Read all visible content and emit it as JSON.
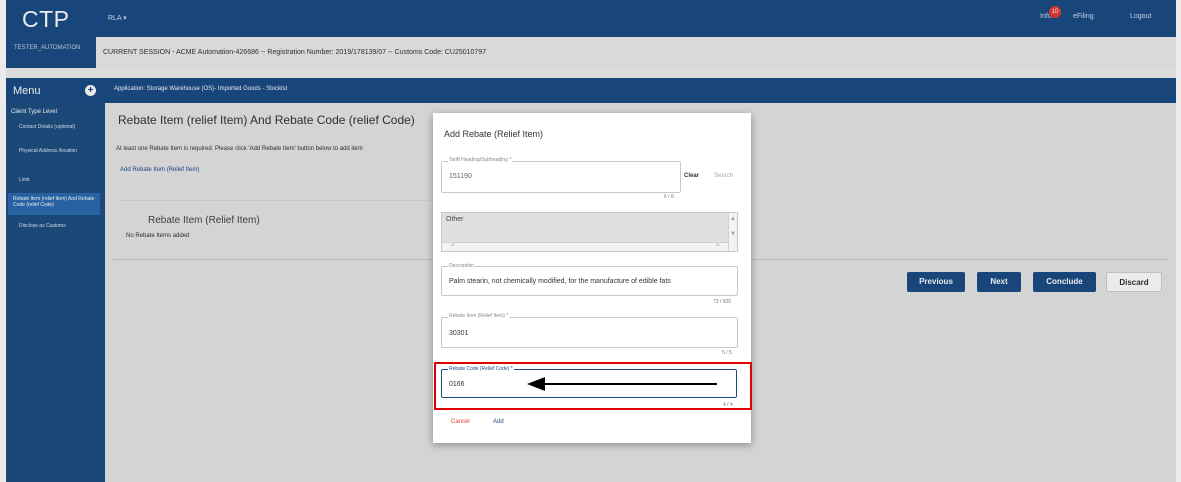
{
  "header": {
    "logo": "CTP",
    "user": "TESTER_AUTOMATION",
    "rla": "RLA ▾",
    "info_label": "Info",
    "info_count": "10",
    "efiling": "eFiling",
    "logout": "Logout",
    "session": "CURRENT SESSION - ACME Automation-426686 -- Registration Number: 2019/178139/07 -- Customs Code: CU25010797"
  },
  "sidebar": {
    "title": "Menu",
    "level": "Client Type Level",
    "items": [
      "Contact Details (optional)",
      "Physical Address /location",
      "Limit",
      "Rebate Item (relief Item) And Rebate Code (relief Code)",
      "Disclose as Customs"
    ]
  },
  "main": {
    "application": "Application: Storage Warehouse (OS)- Imported Goods - Stockist",
    "title": "Rebate Item (relief Item) And Rebate Code (relief Code)",
    "notice": "At least one Rebate Item is required. Please click 'Add Rebate Item' button below to add item",
    "add_link": "Add Rebate Item (Relief Item)",
    "card_title": "Rebate Item (Relief Item)",
    "no_items": "No Rebate Items added",
    "buttons": {
      "previous": "Previous",
      "next": "Next",
      "conclude": "Conclude",
      "discard": "Discard"
    }
  },
  "modal": {
    "title": "Add Rebate (Relief Item)",
    "tariff": {
      "label": "Tariff Heading/Subheading *",
      "value": "151190",
      "counter": "6 / 6",
      "clear": "Clear",
      "search": "Search"
    },
    "list_value": "Other",
    "description": {
      "label": "Description",
      "value": "Palm stearin, not chemically modified, for the manufacture of edible fats",
      "counter": "73 / 600"
    },
    "rebate_item": {
      "label": "Rebate Item (Relief Item) *",
      "value": "30301",
      "counter": "5 / 5"
    },
    "rebate_code": {
      "label": "Rebate Code (Relief Code) *",
      "value": "0166",
      "counter": "4 / 4"
    },
    "cancel": "Cancel",
    "add": "Add"
  },
  "colors": {
    "brand": "#1b4c86",
    "highlight": "#e00000",
    "cancel": "#e53935"
  }
}
